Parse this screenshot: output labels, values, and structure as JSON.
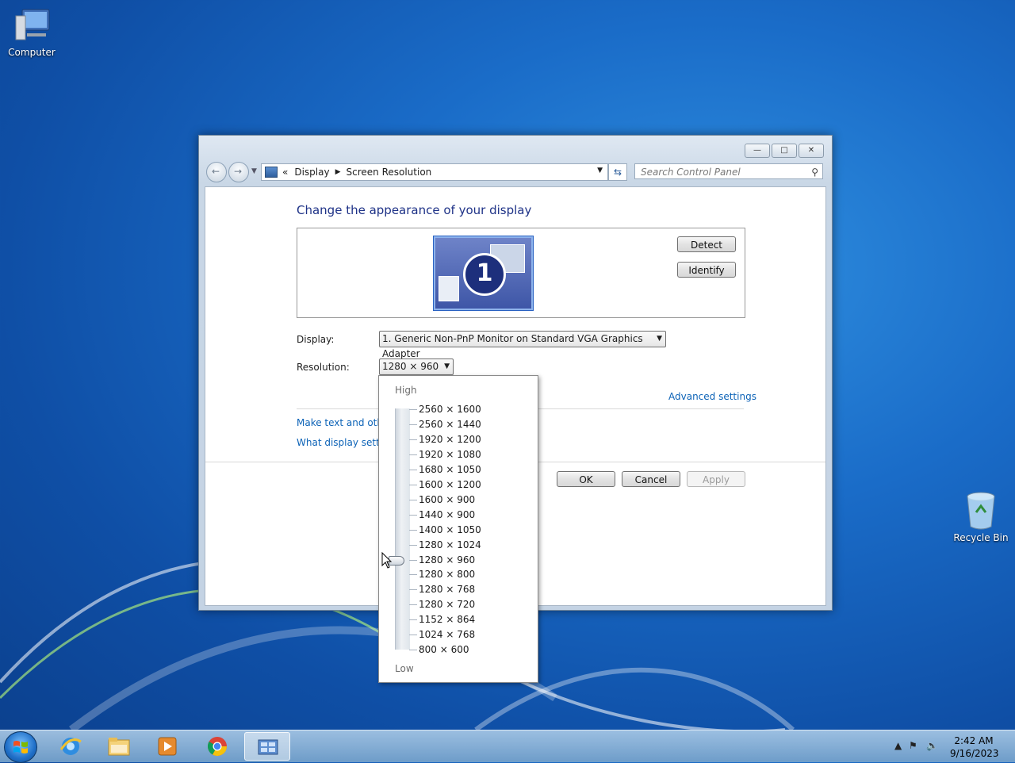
{
  "desktop": {
    "icons": [
      {
        "label": "Computer",
        "icon": "computer-icon"
      },
      {
        "label": "Recycle Bin",
        "icon": "recycle-bin-icon"
      }
    ]
  },
  "window": {
    "nav": {
      "back": "back-arrow-icon",
      "forward": "forward-arrow-icon"
    },
    "address": {
      "prefix": "«",
      "crumbs": [
        "Display",
        "Screen Resolution"
      ]
    },
    "search": {
      "placeholder": "Search Control Panel"
    },
    "heading": "Change the appearance of your display",
    "monitor_number": "1",
    "buttons": {
      "detect": "Detect",
      "identify": "Identify",
      "ok": "OK",
      "cancel": "Cancel",
      "apply": "Apply"
    },
    "display_label": "Display:",
    "display_value": "1. Generic Non-PnP Monitor on Standard VGA Graphics Adapter",
    "resolution_label": "Resolution:",
    "resolution_value": "1280 × 960",
    "advanced_settings": "Advanced settings",
    "links": [
      "Make text and other",
      "What display setting"
    ]
  },
  "resolution_popup": {
    "high": "High",
    "low": "Low",
    "options": [
      "2560 × 1600",
      "2560 × 1440",
      "1920 × 1200",
      "1920 × 1080",
      "1680 × 1050",
      "1600 × 1200",
      "1600 × 900",
      "1440 × 900",
      "1400 × 1050",
      "1280 × 1024",
      "1280 × 960",
      "1280 × 800",
      "1280 × 768",
      "1280 × 720",
      "1152 × 864",
      "1024 × 768",
      "800 × 600"
    ],
    "selected_index": 10
  },
  "taskbar": {
    "apps": [
      "internet-explorer-icon",
      "file-explorer-icon",
      "media-player-icon",
      "chrome-icon",
      "control-panel-icon"
    ],
    "active": "control-panel-icon",
    "clock": {
      "time": "2:42 AM",
      "date": "9/16/2023"
    }
  }
}
